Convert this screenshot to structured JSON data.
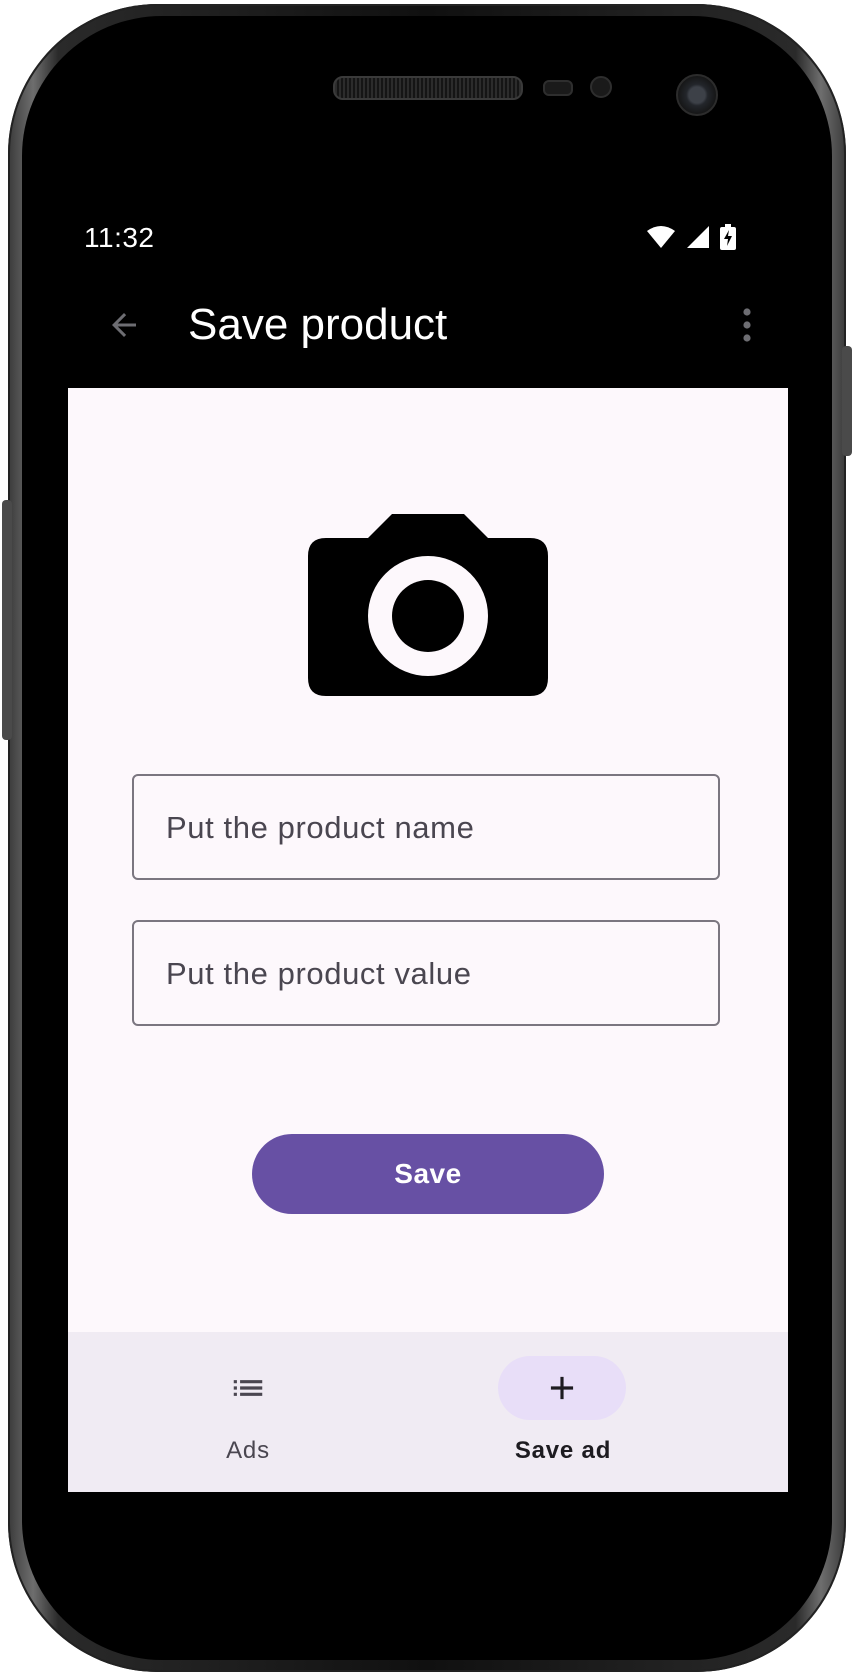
{
  "status_bar": {
    "time": "11:32",
    "icons": [
      "wifi-icon",
      "cell-signal-icon",
      "battery-charging-icon"
    ]
  },
  "app_bar": {
    "title": "Save product",
    "back_icon": "arrow-back-icon",
    "menu_icon": "more-vert-icon"
  },
  "form": {
    "image_icon": "camera-icon",
    "name_field": {
      "placeholder": "Put the product name",
      "value": ""
    },
    "value_field": {
      "placeholder": "Put the product value",
      "value": ""
    },
    "save_label": "Save"
  },
  "bottom_nav": {
    "items": [
      {
        "label": "Ads",
        "icon": "list-icon",
        "selected": false
      },
      {
        "label": "Save ad",
        "icon": "add-icon",
        "selected": true
      }
    ]
  },
  "colors": {
    "primary": "#6750a4",
    "background": "#fdf8fc",
    "nav_background": "#f0ebf3",
    "nav_indicator": "#e8def8",
    "app_bar": "#000000"
  }
}
